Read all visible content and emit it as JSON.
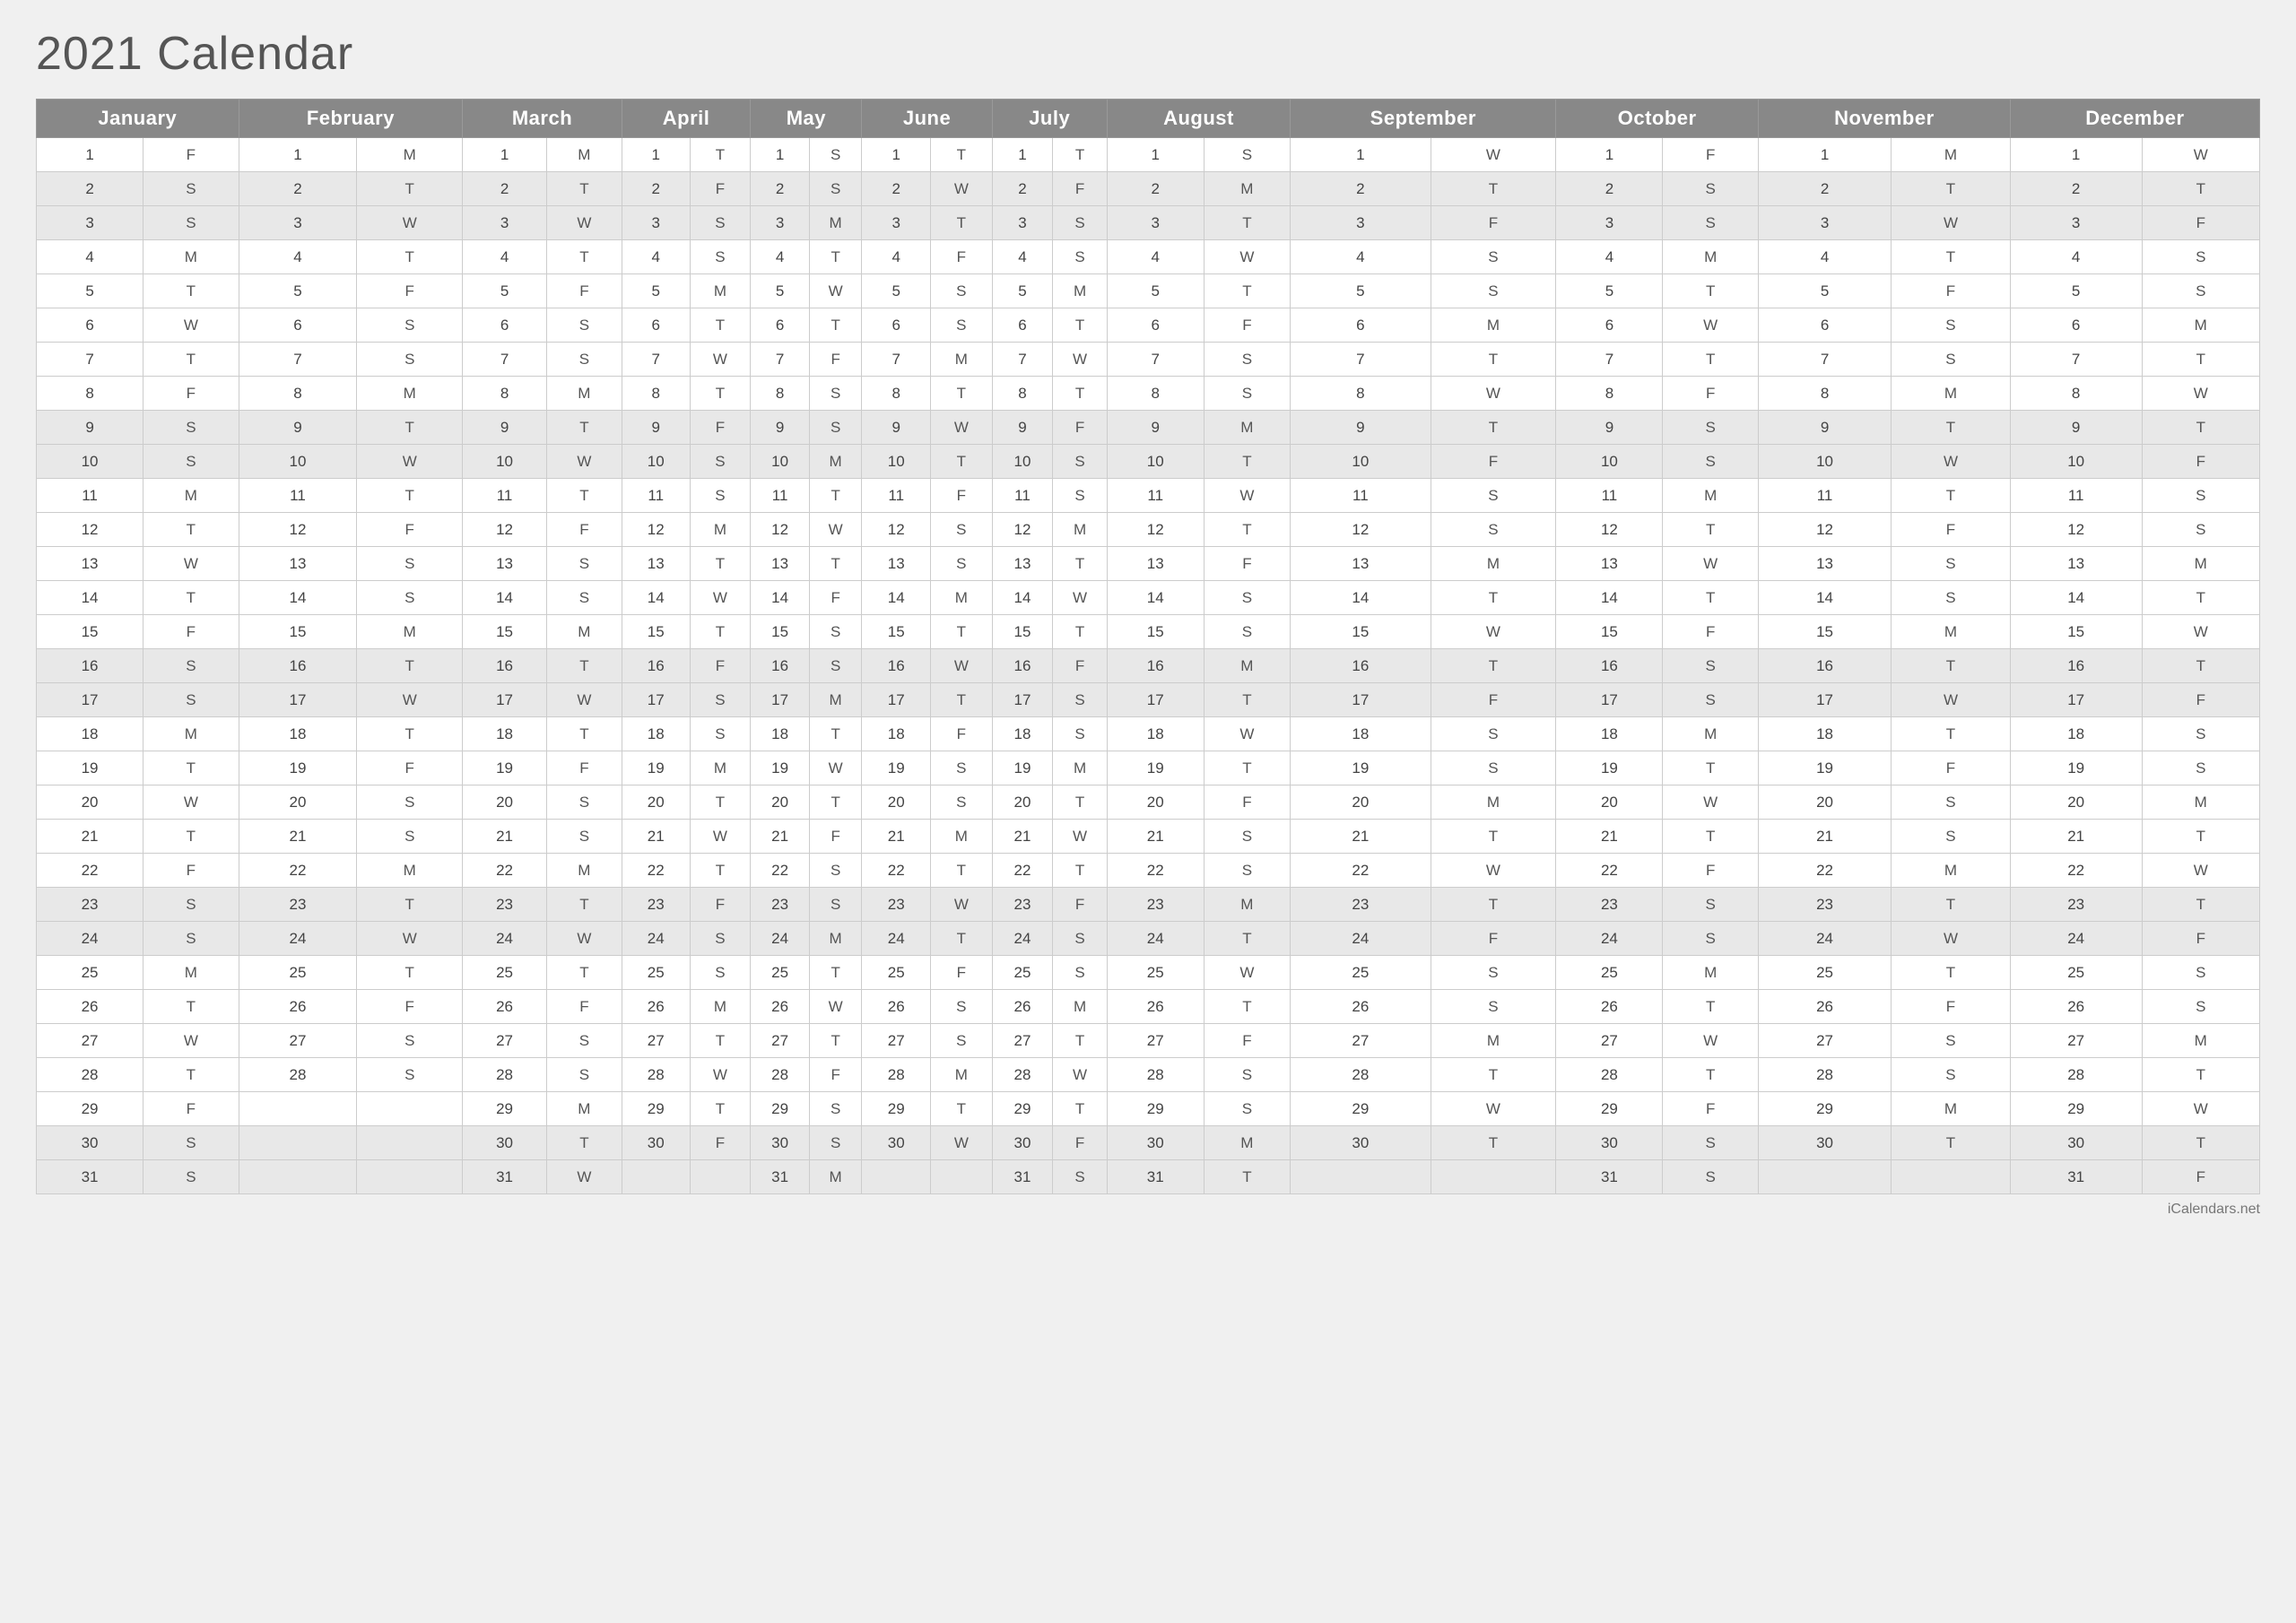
{
  "title": "2021 Calendar",
  "footer": "iCalendars.net",
  "months": [
    "January",
    "February",
    "March",
    "April",
    "May",
    "June",
    "July",
    "August",
    "September",
    "October",
    "November",
    "December"
  ],
  "days": {
    "Jan": [
      "F",
      "S",
      "S",
      "M",
      "T",
      "W",
      "T",
      "F",
      "S",
      "S",
      "M",
      "T",
      "W",
      "T",
      "F",
      "S",
      "S",
      "M",
      "T",
      "W",
      "T",
      "F",
      "S",
      "S",
      "M",
      "T",
      "W",
      "T",
      "F",
      "S",
      "S"
    ],
    "Feb": [
      "M",
      "T",
      "W",
      "T",
      "F",
      "S",
      "S",
      "M",
      "T",
      "W",
      "T",
      "F",
      "S",
      "S",
      "M",
      "T",
      "W",
      "T",
      "F",
      "S",
      "S",
      "M",
      "T",
      "W",
      "T",
      "F",
      "S",
      "S",
      "",
      "",
      ""
    ],
    "Mar": [
      "M",
      "T",
      "W",
      "T",
      "F",
      "S",
      "S",
      "M",
      "T",
      "W",
      "T",
      "F",
      "S",
      "S",
      "M",
      "T",
      "W",
      "T",
      "F",
      "S",
      "S",
      "M",
      "T",
      "W",
      "T",
      "F",
      "S",
      "S",
      "M",
      "T",
      "W"
    ],
    "Apr": [
      "T",
      "F",
      "S",
      "S",
      "M",
      "T",
      "W",
      "T",
      "F",
      "S",
      "S",
      "M",
      "T",
      "W",
      "T",
      "F",
      "S",
      "S",
      "M",
      "T",
      "W",
      "T",
      "F",
      "S",
      "S",
      "M",
      "T",
      "W",
      "T",
      "F",
      ""
    ],
    "May": [
      "S",
      "S",
      "M",
      "T",
      "W",
      "T",
      "F",
      "S",
      "S",
      "M",
      "T",
      "W",
      "T",
      "F",
      "S",
      "S",
      "M",
      "T",
      "W",
      "T",
      "F",
      "S",
      "S",
      "M",
      "T",
      "W",
      "T",
      "F",
      "S",
      "S",
      "M"
    ],
    "Jun": [
      "T",
      "W",
      "T",
      "F",
      "S",
      "S",
      "M",
      "T",
      "W",
      "T",
      "F",
      "S",
      "S",
      "M",
      "T",
      "W",
      "T",
      "F",
      "S",
      "S",
      "M",
      "T",
      "W",
      "T",
      "F",
      "S",
      "S",
      "M",
      "T",
      "W",
      ""
    ],
    "Jul": [
      "T",
      "F",
      "S",
      "S",
      "M",
      "T",
      "W",
      "T",
      "F",
      "S",
      "S",
      "M",
      "T",
      "W",
      "T",
      "F",
      "S",
      "S",
      "M",
      "T",
      "W",
      "T",
      "F",
      "S",
      "S",
      "M",
      "T",
      "W",
      "T",
      "F",
      "S"
    ],
    "Aug": [
      "S",
      "M",
      "T",
      "W",
      "T",
      "F",
      "S",
      "S",
      "M",
      "T",
      "W",
      "T",
      "F",
      "S",
      "S",
      "M",
      "T",
      "W",
      "T",
      "F",
      "S",
      "S",
      "M",
      "T",
      "W",
      "T",
      "F",
      "S",
      "S",
      "M",
      "T"
    ],
    "Sep": [
      "W",
      "T",
      "F",
      "S",
      "S",
      "M",
      "T",
      "W",
      "T",
      "F",
      "S",
      "S",
      "M",
      "T",
      "W",
      "T",
      "F",
      "S",
      "S",
      "M",
      "T",
      "W",
      "T",
      "F",
      "S",
      "S",
      "M",
      "T",
      "W",
      "T",
      ""
    ],
    "Oct": [
      "F",
      "S",
      "S",
      "M",
      "T",
      "W",
      "T",
      "F",
      "S",
      "S",
      "M",
      "T",
      "W",
      "T",
      "F",
      "S",
      "S",
      "M",
      "T",
      "W",
      "T",
      "F",
      "S",
      "S",
      "M",
      "T",
      "W",
      "T",
      "F",
      "S",
      "S"
    ],
    "Nov": [
      "M",
      "T",
      "W",
      "T",
      "F",
      "S",
      "S",
      "M",
      "T",
      "W",
      "T",
      "F",
      "S",
      "S",
      "M",
      "T",
      "W",
      "T",
      "F",
      "S",
      "S",
      "M",
      "T",
      "W",
      "T",
      "F",
      "S",
      "S",
      "M",
      "T",
      ""
    ],
    "Dec": [
      "W",
      "T",
      "F",
      "S",
      "S",
      "M",
      "T",
      "W",
      "T",
      "F",
      "S",
      "S",
      "M",
      "T",
      "W",
      "T",
      "F",
      "S",
      "S",
      "M",
      "T",
      "W",
      "T",
      "F",
      "S",
      "S",
      "M",
      "T",
      "W",
      "T",
      "F"
    ]
  }
}
